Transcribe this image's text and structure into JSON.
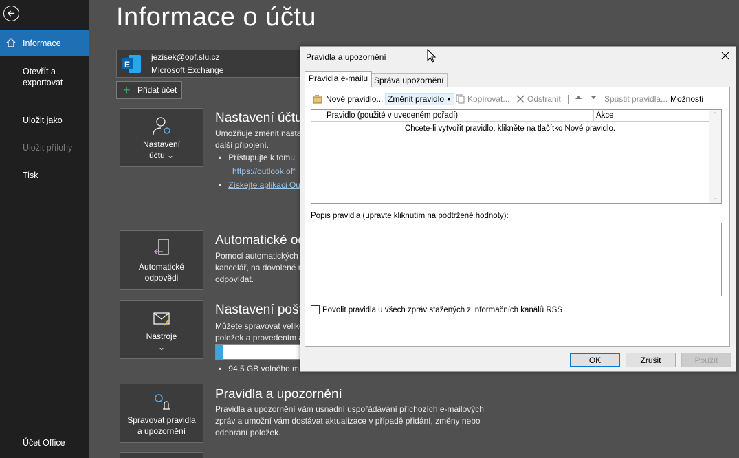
{
  "nav": {
    "items": [
      {
        "label": "Informace",
        "active": true
      },
      {
        "label": "Otevřít a exportovat"
      },
      {
        "label": "Uložit jako"
      },
      {
        "label": "Uložit přílohy",
        "disabled": true
      },
      {
        "label": "Tisk"
      }
    ],
    "footer": "Účet Office"
  },
  "main": {
    "title": "Informace o účtu",
    "account": {
      "email": "jezisek@opf.slu.cz",
      "type": "Microsoft Exchange"
    },
    "add_account": "Přidat účet",
    "sections": [
      {
        "tile_label_1": "Nastavení",
        "tile_label_2": "účtu ⌄",
        "title": "Nastavení účtu",
        "text": [
          "Umožňuje změnit nasta",
          "další připojení."
        ],
        "bullets": [
          "Přístupujte k tomu",
          "https://outlook.off",
          "Získejte aplikaci Ou"
        ]
      },
      {
        "tile_label_1": "Automatické",
        "tile_label_2": "odpovědi",
        "title": "Automatické od",
        "text": [
          "Pomocí automatických",
          "kancelář, na dovolené r",
          "odpovídat."
        ]
      },
      {
        "tile_label_1": "Nástroje",
        "tile_label_2": "⌄",
        "title": "Nastavení pošt",
        "text": [
          "Můžete spravovat veliko",
          "položek a provedením a"
        ],
        "storage_text": "94,5 GB volného m",
        "storage_used_fraction": 0.08
      },
      {
        "tile_label_1": "Spravovat pravidla",
        "tile_label_2": "a upozornění",
        "title": "Pravidla a upozornění",
        "text": [
          "Pravidla a upozornění vám usnadní uspořádávání příchozích e-mailových",
          "zpráv a umožní vám dostávat aktualizace v případě přidání, změny nebo",
          "odebrání položek."
        ]
      }
    ]
  },
  "dialog": {
    "title": "Pravidla a upozornění",
    "tabs": [
      "Pravidla e-mailu",
      "Správa upozornění"
    ],
    "toolbar": {
      "new_rule": "Nové pravidlo...",
      "change_rule": "Změnit pravidlo",
      "copy": "Kopírovat...",
      "delete": "Odstranit",
      "run_rules": "Spustit pravidla...",
      "options": "Možnosti"
    },
    "list": {
      "col_rule": "Pravidlo (použité v uvedeném pořadí)",
      "col_action": "Akce",
      "empty": "Chcete-li vytvořit pravidlo, klikněte na tlačítko Nové pravidlo."
    },
    "desc_label": "Popis pravidla (upravte kliknutím na podtržené hodnoty):",
    "rss_label": "Povolit pravidla u všech zpráv stažených z informačních kanálů RSS",
    "buttons": {
      "ok": "OK",
      "cancel": "Zrušit",
      "apply": "Použít"
    }
  },
  "colors": {
    "nav_active": "#1f6fb5",
    "accent": "#0078d7"
  }
}
